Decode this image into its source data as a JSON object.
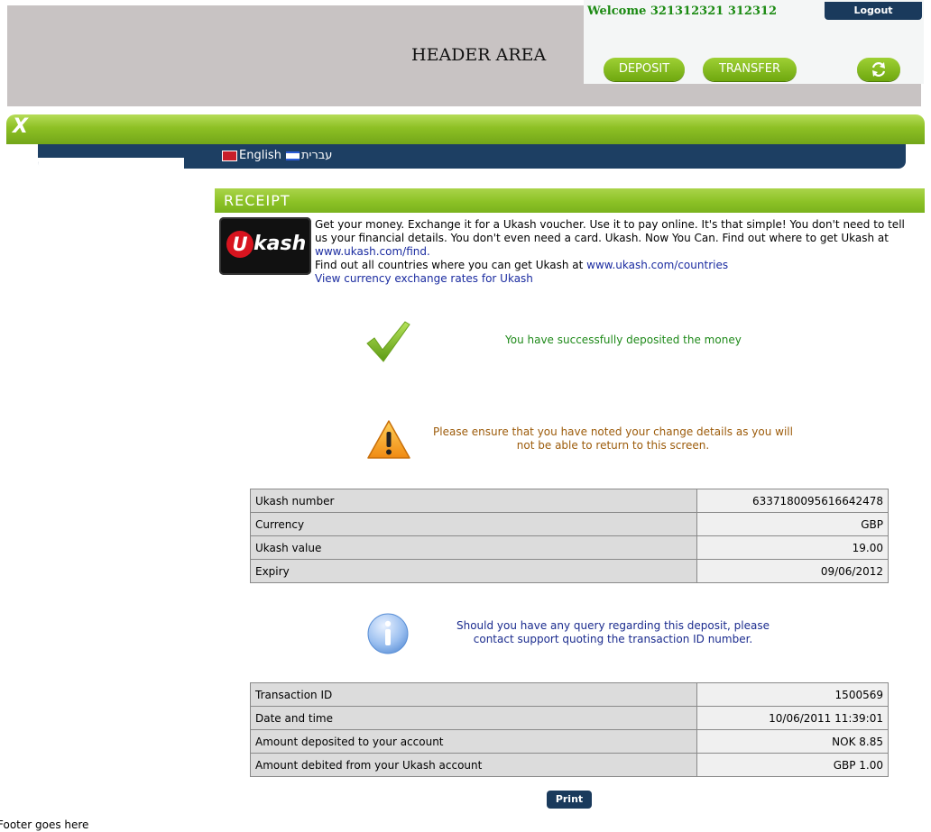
{
  "header": {
    "title": "HEADER AREA",
    "welcome": "Welcome 321312321 312312",
    "logout_label": "Logout",
    "deposit_label": "DEPOSIT",
    "transfer_label": "TRANSFER",
    "refresh_icon": "refresh-arrows-icon"
  },
  "nav": {
    "logo_text": "X",
    "languages": [
      {
        "label": "English",
        "flag": "uk-flag-icon"
      },
      {
        "label": "עברית",
        "flag": "israel-flag-icon"
      }
    ]
  },
  "receipt": {
    "title": "RECEIPT",
    "logo_u": "U",
    "logo_kash": "kash",
    "intro_text": "Get your money. Exchange it for a Ukash voucher. Use it to pay online. It's that simple! You don't need to tell us your financial details. You don't even need a card. Ukash. Now You Can. Find out where to get Ukash at",
    "intro_link": "www.ukash.com/find.",
    "countries_text": "Find out all countries where you can get Ukash at",
    "countries_link": "www.ukash.com/countries",
    "rates_link": "View currency exchange rates for Ukash",
    "success_msg": "You have successfully deposited the money",
    "warning_msg": "Please ensure that you have noted your change details as you will not be able to return to this screen.",
    "info_msg": "Should you have any query regarding this deposit, please contact support quoting the transaction ID number.",
    "ukash_rows": [
      {
        "label": "Ukash number",
        "value": "6337180095616642478"
      },
      {
        "label": "Currency",
        "value": "GBP"
      },
      {
        "label": "Ukash value",
        "value": "19.00"
      },
      {
        "label": "Expiry",
        "value": "09/06/2012"
      }
    ],
    "transaction_rows": [
      {
        "label": "Transaction ID",
        "value": "1500569"
      },
      {
        "label": "Date and time",
        "value": "10/06/2011 11:39:01"
      },
      {
        "label": "Amount deposited to your account",
        "value": "NOK 8.85"
      },
      {
        "label": "Amount debited from your Ukash account",
        "value": "GBP 1.00"
      }
    ],
    "print_label": "Print"
  },
  "footer": {
    "text": "Footer goes here"
  },
  "colors": {
    "green_accent": "#8cc226",
    "navy": "#1a3a5c",
    "success_text": "#1f8a1a",
    "warning_text": "#9c5b0a",
    "info_text": "#1a2b8e"
  }
}
